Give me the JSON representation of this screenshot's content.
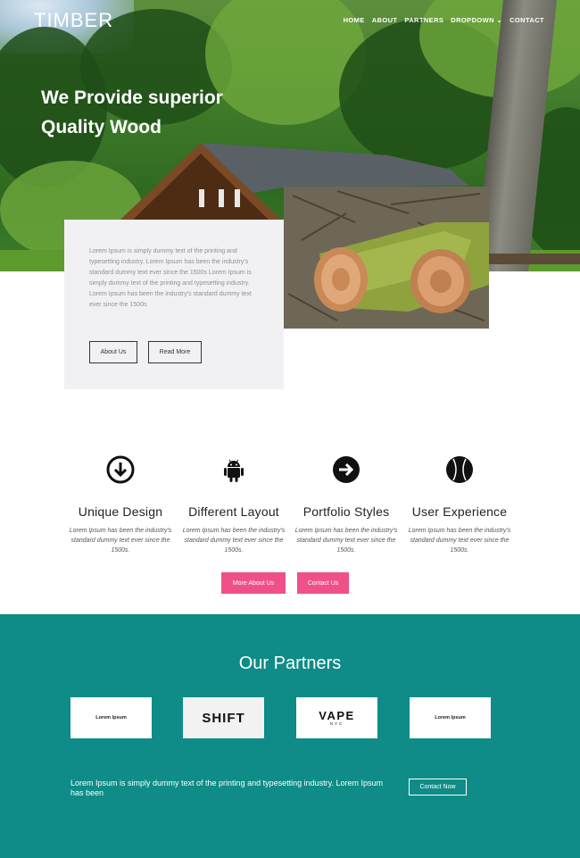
{
  "header": {
    "logo": "TIMBER",
    "nav": [
      "HOME",
      "ABOUT",
      "PARTNERS",
      "DROPDOWN",
      "CONTACT"
    ]
  },
  "hero": {
    "title": "We Provide superior Quality Wood"
  },
  "card": {
    "text": "Lorem Ipsum is simply dummy text of the printing and typesetting industry. Lorem Ipsum has been the industry's standard dummy text ever since the 1500s Lorem Ipsum is simply dummy text of the printing and typesetting industry. Lorem Ipsum has been the industry's standard dummy text ever since the 1500s",
    "about_button": "About Us",
    "read_more_button": "Read More"
  },
  "features": [
    {
      "title": "Unique Design",
      "icon": "download-circle-icon",
      "text": "Lorem Ipsum has been the industry's standard dummy text ever since the 1500s."
    },
    {
      "title": "Different Layout",
      "icon": "android-icon",
      "text": "Lorem Ipsum has been the industry's standard dummy text ever since the 1500s."
    },
    {
      "title": "Portfolio Styles",
      "icon": "arrow-right-circle-icon",
      "text": "Lorem Ipsum has been the industry's standard dummy text ever since the 1500s."
    },
    {
      "title": "User Experience",
      "icon": "baseball-icon",
      "text": "Lorem Ipsum has been the industry's standard dummy text ever since the 1500s."
    }
  ],
  "feature_buttons": {
    "more_about": "More About Us",
    "contact": "Contact Us"
  },
  "partners": {
    "heading": "Our Partners",
    "logos": [
      "Lorem Ipsum",
      "SHIFT",
      "VAPE",
      "NYC",
      "Lorem Ipsum"
    ],
    "bottom_text": "Lorem Ipsum is simply dummy text of the printing and typesetting industry. Lorem Ipsum has been",
    "contact_now": "Contact Now"
  },
  "colors": {
    "accent_pink": "#f0508a",
    "teal": "#0f8c87"
  }
}
